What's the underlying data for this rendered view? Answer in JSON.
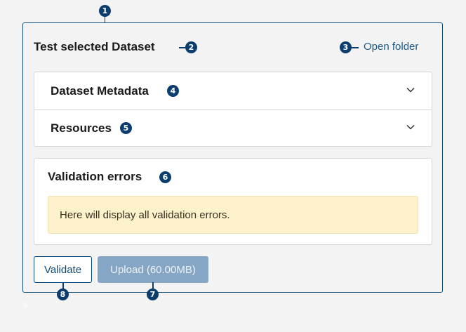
{
  "panel": {
    "title": "Test selected Dataset",
    "open_folder_label": "Open folder"
  },
  "accordion": {
    "items": [
      {
        "label": "Dataset Metadata",
        "icon": "chevron-down-icon"
      },
      {
        "label": "Resources",
        "icon": "chevron-down-icon"
      }
    ]
  },
  "validation": {
    "title": "Validation errors",
    "message": "Here will display all validation errors."
  },
  "actions": {
    "validate_label": "Validate",
    "upload_label": "Upload (60.00MB)"
  },
  "annotations": [
    "1",
    "2",
    "3",
    "4",
    "5",
    "6",
    "7",
    "8"
  ],
  "stray_mark": "5",
  "colors": {
    "accent": "#0b4a7a",
    "badge": "#0b3d6e",
    "link": "#1a5b8c",
    "upload_disabled": "#86a6c5",
    "warning_bg": "#fdf1cc"
  }
}
